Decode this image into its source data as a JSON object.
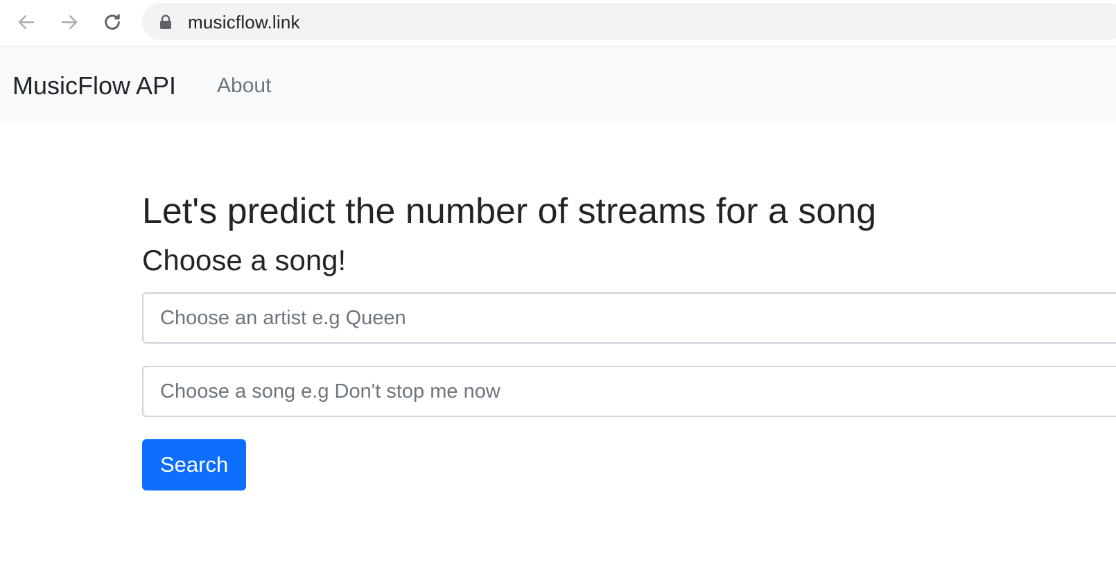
{
  "browser": {
    "url": "musicflow.link",
    "icons": [
      "back-arrow-icon",
      "forward-arrow-icon",
      "reload-icon",
      "lock-icon"
    ]
  },
  "navbar": {
    "brand": "MusicFlow API",
    "links": [
      {
        "label": "About"
      }
    ]
  },
  "main": {
    "title": "Let's predict the number of streams for a song",
    "subtitle": "Choose a song!",
    "artist_input": {
      "placeholder": "Choose an artist e.g Queen",
      "value": ""
    },
    "song_input": {
      "placeholder": "Choose a song e.g Don't stop me now",
      "value": ""
    },
    "search_button_label": "Search"
  },
  "colors": {
    "primary": "#0d6efd",
    "navbar_bg": "#f8f9fa",
    "text": "#212529",
    "muted": "#6c757d"
  }
}
